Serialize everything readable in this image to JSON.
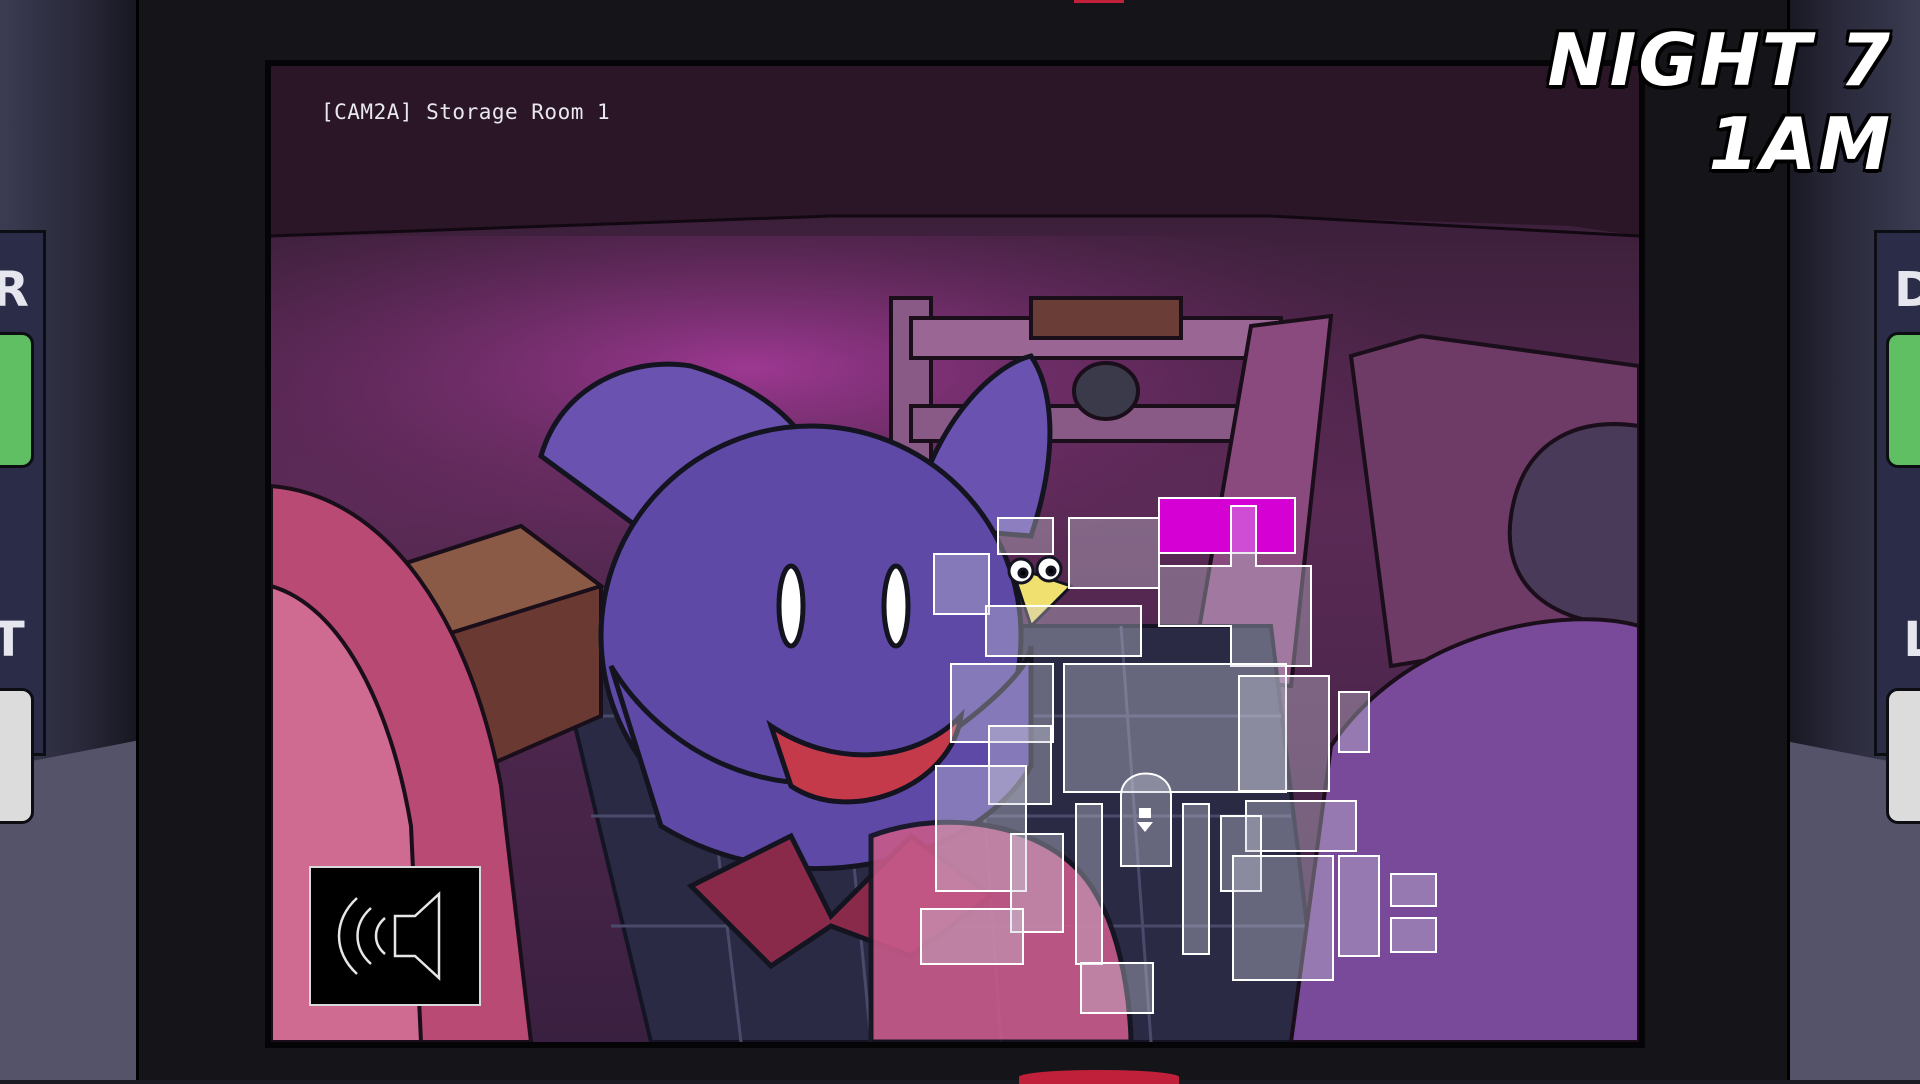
{
  "hud": {
    "night": "NIGHT 7",
    "time": "1AM"
  },
  "camera": {
    "label": "[CAM2A] Storage Room 1",
    "audio_button_icon": "speaker-sound-icon"
  },
  "side_panels": {
    "left_letters": [
      "R",
      "T"
    ],
    "right_letters": [
      "D",
      "L"
    ]
  },
  "colors": {
    "selected_room": "#d400d4",
    "map_room_fill": "rgba(200,200,215,0.38)",
    "map_room_stroke": "#ffffff",
    "side_button_green": "#5fbf62",
    "side_button_white": "#dcdcdc",
    "accent_red": "#c0203a"
  },
  "map": {
    "selected_room_name": "CAM2A",
    "you_marker_icon": "office-pin-icon"
  }
}
